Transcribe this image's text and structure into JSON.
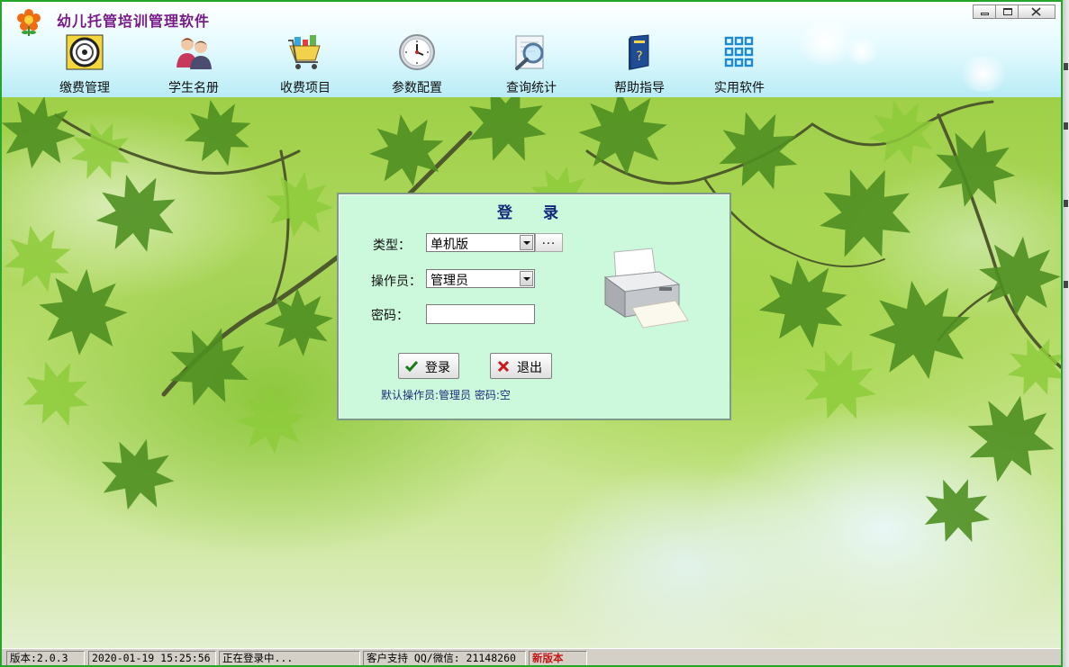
{
  "app": {
    "title": "幼儿托管培训管理软件"
  },
  "toolbar": {
    "items": [
      {
        "label": "缴费管理",
        "icon": "payment-wheel-icon"
      },
      {
        "label": "学生名册",
        "icon": "students-people-icon"
      },
      {
        "label": "收费项目",
        "icon": "cart-items-icon"
      },
      {
        "label": "参数配置",
        "icon": "clock-settings-icon"
      },
      {
        "label": "查询统计",
        "icon": "magnifier-query-icon"
      },
      {
        "label": "帮助指导",
        "icon": "help-book-icon"
      },
      {
        "label": "实用软件",
        "icon": "apps-grid-icon"
      }
    ]
  },
  "login": {
    "title": "登 录",
    "type_label": "类型：",
    "type_value": "单机版",
    "more_label": "...",
    "operator_label": "操作员：",
    "operator_value": "管理员",
    "password_label": "密码：",
    "password_value": "",
    "login_button": "登录",
    "exit_button": "退出",
    "hint": "默认操作员:管理员 密码:空"
  },
  "status": {
    "version": "版本:2.0.3",
    "datetime": "2020-01-19 15:25:56",
    "message": "正在登录中...",
    "support": "客户支持 QQ/微信: 21148260",
    "new_version": "新版本"
  },
  "colors": {
    "window_border": "#25a52a",
    "title_text": "#7a1a8a",
    "dialog_bg": "#ccf8dc",
    "dialog_title": "#12287a",
    "new_version": "#c81717"
  }
}
